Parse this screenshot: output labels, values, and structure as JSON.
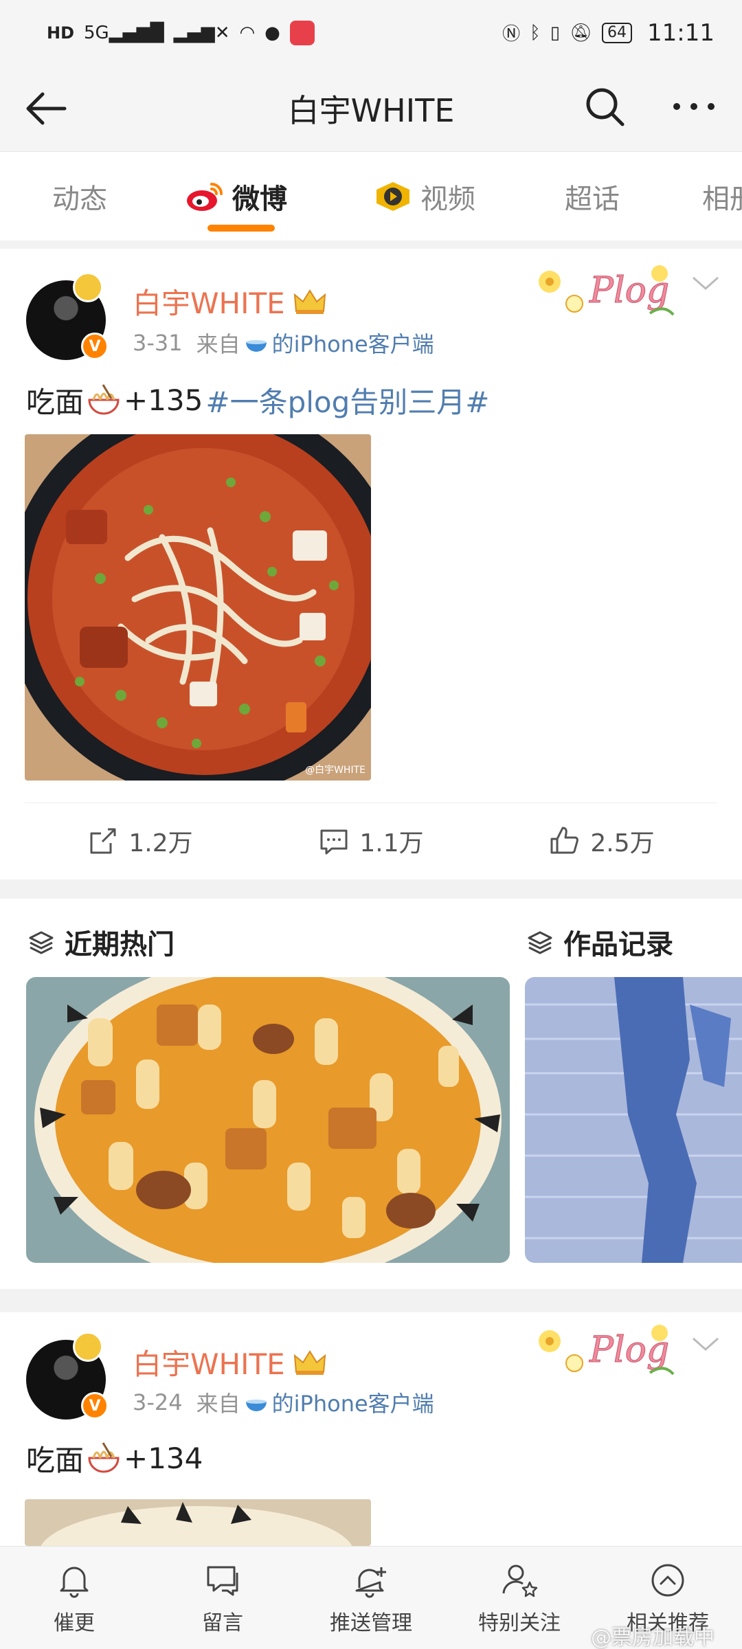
{
  "status_bar": {
    "hd_label": "HD",
    "network": "5G",
    "battery": "64",
    "time": "11:11"
  },
  "header": {
    "title": "白宇WHITE",
    "back_icon": "arrow-left-icon",
    "search_icon": "search-icon",
    "more_icon": "more-icon"
  },
  "tabs": [
    {
      "label": "动态",
      "active": false
    },
    {
      "label": "微博",
      "active": true,
      "icon": "weibo-icon"
    },
    {
      "label": "视频",
      "active": false,
      "icon": "video-icon"
    },
    {
      "label": "超话",
      "active": false
    },
    {
      "label": "相册",
      "active": false
    }
  ],
  "posts": [
    {
      "author": "白宇WHITE",
      "date": "3-31",
      "source_prefix": "来自",
      "source": "的iPhone客户端",
      "text": "吃面",
      "count": "+135",
      "topic": "#一条plog告别三月#",
      "image_watermark": "@白宇WHITE",
      "stats": {
        "repost": "1.2万",
        "comment": "1.1万",
        "like": "2.5万"
      }
    },
    {
      "author": "白宇WHITE",
      "date": "3-24",
      "source_prefix": "来自",
      "source": "的iPhone客户端",
      "text": "吃面",
      "count": "+134"
    }
  ],
  "albums": {
    "recent_hot": "近期热门",
    "works": "作品记录"
  },
  "bottom_nav": [
    {
      "label": "催更",
      "icon": "bell-icon"
    },
    {
      "label": "留言",
      "icon": "message-icon"
    },
    {
      "label": "推送管理",
      "icon": "bell-plus-icon"
    },
    {
      "label": "特别关注",
      "icon": "user-star-icon"
    },
    {
      "label": "相关推荐",
      "icon": "chevron-up-circle-icon"
    }
  ],
  "watermark": "@票房加载中",
  "colors": {
    "accent": "#ff8200",
    "author": "#eb7350",
    "link": "#507daf"
  }
}
